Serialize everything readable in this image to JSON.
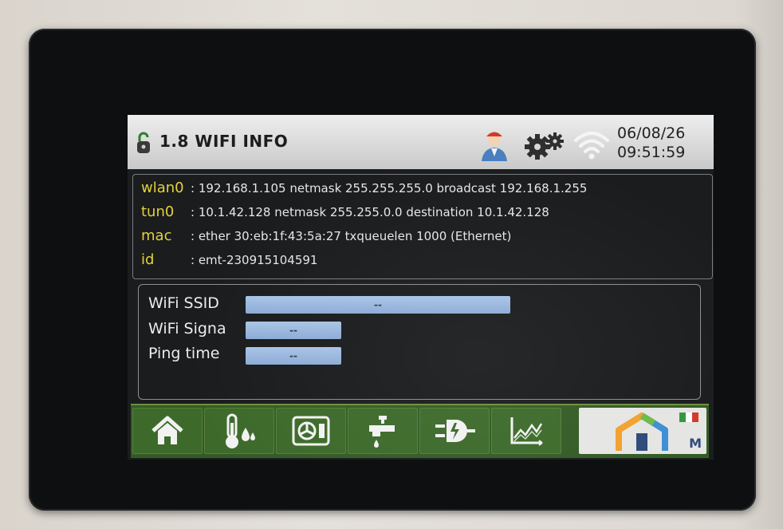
{
  "header": {
    "title": "1.8 WIFI INFO",
    "date": "06/08/26",
    "time": "09:51:59",
    "icons": [
      "lock-icon",
      "user-icon",
      "gear-icon",
      "wifi-icon"
    ]
  },
  "network": [
    {
      "key": "wlan0",
      "value": ": 192.168.1.105 netmask 255.255.255.0 broadcast 192.168.1.255"
    },
    {
      "key": "tun0",
      "value": ": 10.1.42.128 netmask 255.255.0.0 destination 10.1.42.128"
    },
    {
      "key": "mac",
      "value": ": ether 30:eb:1f:43:5a:27 txqueuelen 1000 (Ethernet)"
    },
    {
      "key": "id",
      "value": ": emt-230915104591"
    }
  ],
  "wifi": {
    "ssid_label": "WiFi SSID",
    "ssid_value": "--",
    "signal_label": "WiFi Signa",
    "signal_value": "--",
    "ping_label": "Ping time",
    "ping_value": "--"
  },
  "nav": [
    "home-icon",
    "thermometer-humidity-icon",
    "ventilation-unit-icon",
    "water-tap-icon",
    "power-plug-icon",
    "chart-icon",
    "brand-logo-icon"
  ],
  "brand": {
    "letter": "M"
  },
  "colors": {
    "key_yellow": "#e3d23a",
    "footer_green": "#3d6a2b",
    "field_blue": "#9bb8de"
  }
}
